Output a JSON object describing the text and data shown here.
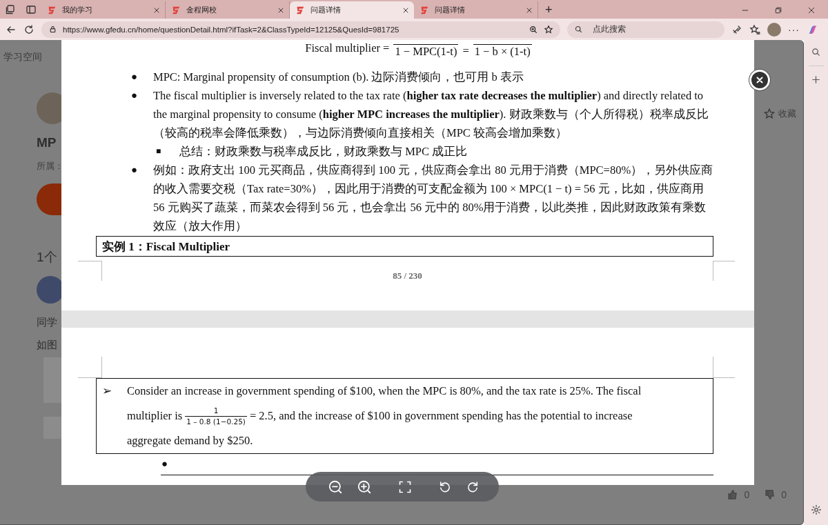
{
  "browser": {
    "tabs": [
      {
        "title": "我的学习",
        "selected": false
      },
      {
        "title": "金程网校",
        "selected": false
      },
      {
        "title": "问题详情",
        "selected": true
      },
      {
        "title": "问题详情",
        "selected": false
      }
    ],
    "new_tab": "+",
    "address": "https://www.gfedu.cn/home/questionDetail.html?ifTask=2&ClassTypeId=12125&QuesId=981725",
    "search_placeholder": "点此搜索",
    "more": "···"
  },
  "page": {
    "breadcrumb": "学习空间",
    "question_title": "MP",
    "belongs_label": "所属：",
    "answers_heading": "1个",
    "answer_intro": "同学",
    "answer_text": "如图",
    "favorite": "收藏",
    "likes": "0",
    "dislikes": "0"
  },
  "viewer": {
    "formula": {
      "label": "Fiscal multiplier =",
      "equals": "=",
      "denominators": [
        "1 − MPC(1-t)",
        "1 − b × (1-t)"
      ]
    },
    "bullets": [
      {
        "kind": "bullet",
        "marker": "●",
        "text": "MPC: Marginal propensity of consumption (b). 边际消费倾向，也可用 b 表示"
      },
      {
        "kind": "bullet",
        "marker": "●",
        "text": "The fiscal multiplier is inversely related to the tax rate (**higher tax rate decreases the multiplier**) and directly related to the marginal propensity to consume (**higher MPC increases the multiplier**). 财政乘数与（个人所得税）税率成反比（较高的税率会降低乘数），与边际消费倾向直接相关（MPC 较高会增加乘数）"
      },
      {
        "kind": "sub",
        "marker": "■",
        "text": "总结：财政乘数与税率成反比，财政乘数与 MPC 成正比"
      },
      {
        "kind": "bullet",
        "marker": "●",
        "text": "例如：政府支出 100 元买商品，供应商得到 100 元，供应商会拿出 80 元用于消费（MPC=80%），另外供应商的收入需要交税（Tax rate=30%），因此用于消费的可支配金额为 100 × MPC(1 − t) = 56 元，比如，供应商用 56 元购买了蔬菜，而菜农会得到 56 元，也会拿出 56 元中的 80%用于消费，以此类推，因此财政政策有乘数效应（放大作用）"
      }
    ],
    "example_title": "实例 1：Fiscal Multiplier",
    "page_number": "85 / 230",
    "example": {
      "marker": "➢",
      "line_1": "Consider an increase in government spending of $100, when the MPC is 80%, and the tax rate is 25%. The fiscal",
      "line_2_start": "multiplier is",
      "numerator": "1",
      "denominator": "1 – 0.8 (1−0.25)",
      "line_2_end": "= 2.5, and the increase of $100 in government spending has the potential to increase",
      "line_3": "aggregate demand by $250."
    },
    "empty_bullet": "●"
  }
}
